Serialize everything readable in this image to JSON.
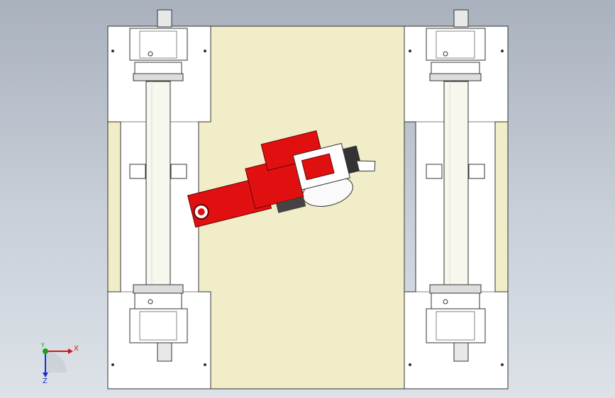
{
  "viewport": {
    "title": "",
    "background_top": "#a9b1bd",
    "background_bottom": "#dde2e8"
  },
  "colors": {
    "panel": "#f2edc9",
    "frame": "#ffffff",
    "robot": "#e01010",
    "robot_dark": "#8a0000",
    "roller": "#f7f7ee",
    "outline": "#333333"
  },
  "axis_triad": {
    "x_label": "X",
    "y_label": "Y",
    "z_label": "Z",
    "x_color": "#d01818",
    "y_color": "#1aa01a",
    "z_color": "#1a2cd0"
  }
}
